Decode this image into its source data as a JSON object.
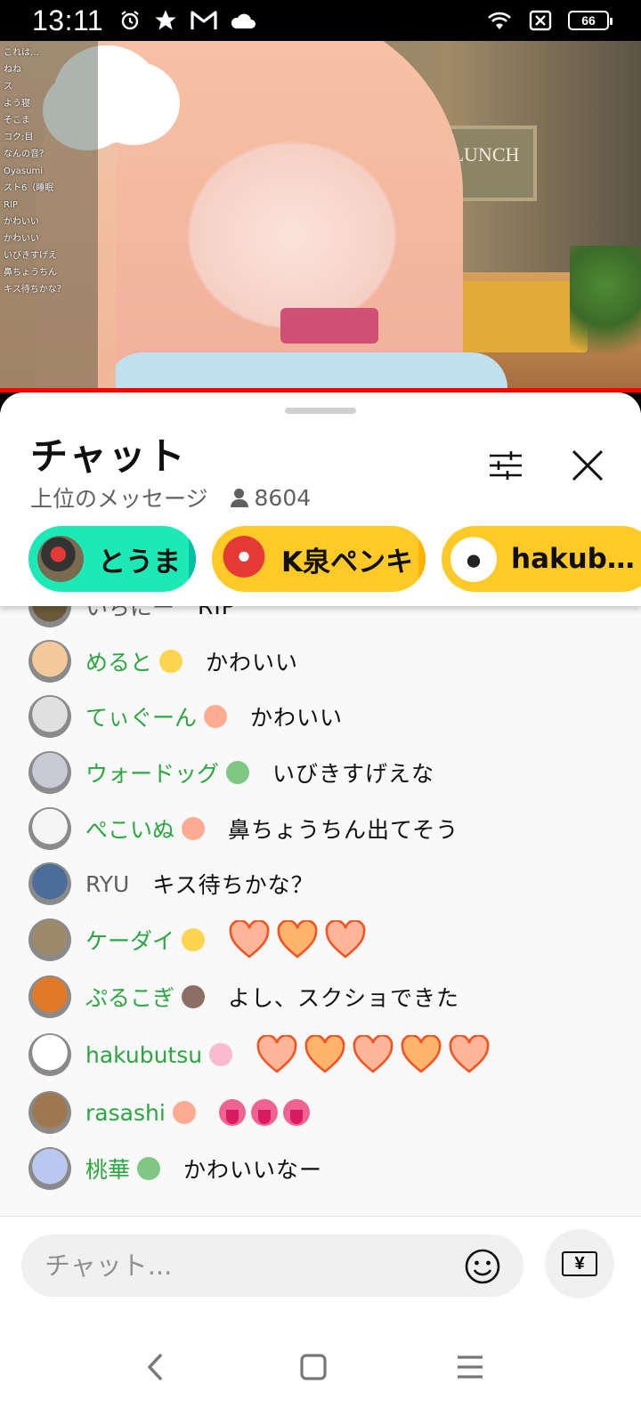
{
  "status_bar": {
    "time": "13:11",
    "battery": "66"
  },
  "video": {
    "sign_text": "LUNCH",
    "overlay_chat": [
      "これは…",
      "ねね",
      "ス",
      "よう寝",
      "そこま",
      "コク:目",
      "なんの音？",
      "Oyasumi",
      "スト6（睡眠",
      "RIP",
      "かわいい",
      "かわいい",
      "いびきすげえ",
      "鼻ちょうちん",
      "キス待ちかな？"
    ]
  },
  "chat_panel": {
    "title": "チャット",
    "mode_label": "上位のメッセージ",
    "viewer_count": "8604"
  },
  "pinned": [
    {
      "label": "とうま",
      "color": "#1de9b6"
    },
    {
      "label": "K泉ペンキ",
      "color": "#ffca28"
    },
    {
      "label": "hakubut…",
      "color": "#ffca28"
    }
  ],
  "messages": [
    {
      "author": "いちにー",
      "member": false,
      "text": "RIP",
      "avatar_color": "#6b5a3a"
    },
    {
      "author": "めると",
      "member": true,
      "text": "かわいい",
      "avatar_color": "#f3c89a"
    },
    {
      "author": "てぃぐーん",
      "member": true,
      "text": "かわいい",
      "avatar_color": "#e0e0e0"
    },
    {
      "author": "ウォードッグ",
      "member": true,
      "text": "いびきすげえな",
      "avatar_color": "#c9c9d6"
    },
    {
      "author": "ぺこいぬ",
      "member": true,
      "text": "鼻ちょうちん出てそう",
      "avatar_color": "#f5f5f5"
    },
    {
      "author": "RYU",
      "member": false,
      "text": "キス待ちかな？",
      "avatar_color": "#4a6d99"
    },
    {
      "author": "ケーダイ",
      "member": true,
      "text": "",
      "emoji": "hearts-3",
      "avatar_color": "#9d8a6a"
    },
    {
      "author": "ぷるこぎ",
      "member": true,
      "text": "よし、スクショできた",
      "avatar_color": "#e07a2a"
    },
    {
      "author": "hakubutsu",
      "member": true,
      "text": "",
      "emoji": "hearts-5",
      "avatar_color": "#ffffff"
    },
    {
      "author": "rasashi",
      "member": true,
      "text": "",
      "emoji": "tongues-3",
      "avatar_color": "#a07850"
    },
    {
      "author": "桃華",
      "member": true,
      "text": "かわいいなー",
      "avatar_color": "#b9c8ee"
    }
  ],
  "input": {
    "placeholder": "チャット...",
    "superchat_symbol": "¥"
  },
  "colors": {
    "member_name": "#2ba640",
    "progress": "#ff0000",
    "heart_fill": "#ffb59a",
    "heart_stroke": "#f4511e"
  }
}
